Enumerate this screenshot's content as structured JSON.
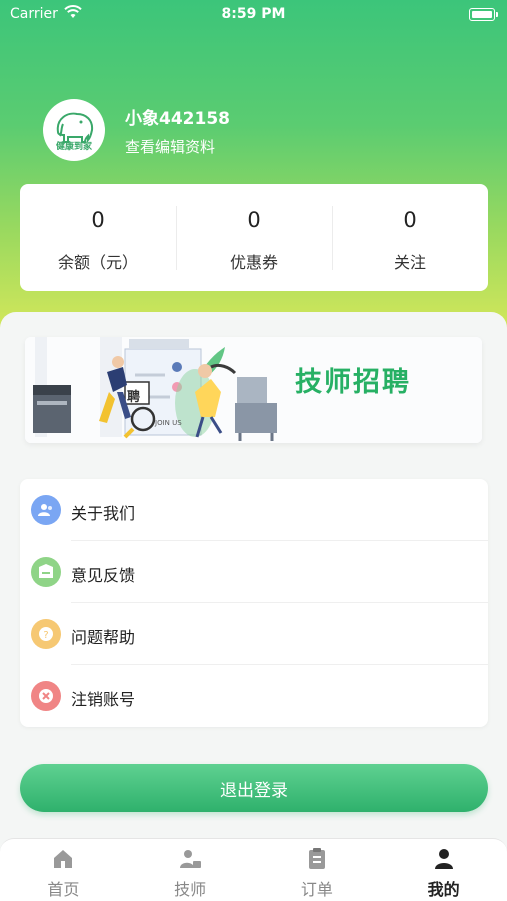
{
  "status_bar": {
    "carrier": "Carrier",
    "time": "8:59 PM"
  },
  "profile": {
    "avatar_text": "健康到家",
    "username": "小象442158",
    "edit_label": "查看编辑资料"
  },
  "stats": [
    {
      "value": "0",
      "label": "余额（元）"
    },
    {
      "value": "0",
      "label": "优惠券"
    },
    {
      "value": "0",
      "label": "关注"
    }
  ],
  "banner": {
    "title": "技师招聘",
    "badge": "聘",
    "sign": "JOIN US"
  },
  "menu": [
    {
      "label": "关于我们",
      "icon": "users-icon",
      "color": "#7aa6f3"
    },
    {
      "label": "意见反馈",
      "icon": "feedback-icon",
      "color": "#8fd487"
    },
    {
      "label": "问题帮助",
      "icon": "help-icon",
      "color": "#f6c873"
    },
    {
      "label": "注销账号",
      "icon": "delete-icon",
      "color": "#f08585"
    }
  ],
  "logout_label": "退出登录",
  "tabs": [
    {
      "label": "首页",
      "icon": "home-icon",
      "active": false
    },
    {
      "label": "技师",
      "icon": "technician-icon",
      "active": false
    },
    {
      "label": "订单",
      "icon": "orders-icon",
      "active": false
    },
    {
      "label": "我的",
      "icon": "profile-icon",
      "active": true
    }
  ],
  "colors": {
    "brand": "#2fb16c",
    "header_top": "#3cc57a",
    "header_bottom": "#d3e75a"
  }
}
